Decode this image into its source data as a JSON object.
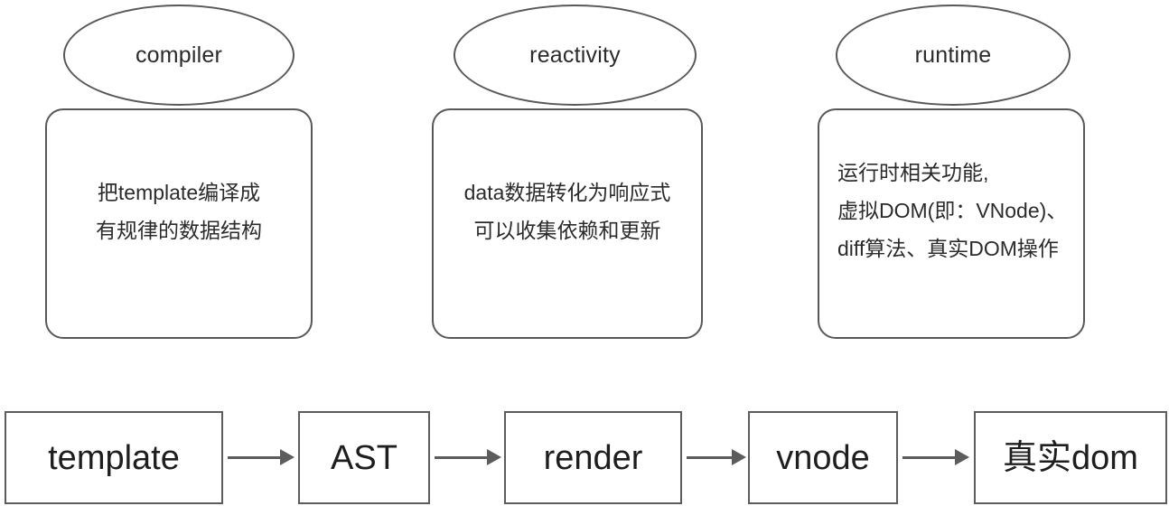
{
  "diagram": {
    "type": "flow-diagram",
    "stroke_color": "#585858",
    "text_color": "#2b2b2b",
    "background": "#ffffff",
    "concepts": [
      {
        "name": "compiler",
        "title": "compiler",
        "description": "把template编译成\n有规律的数据结构",
        "align": "center"
      },
      {
        "name": "reactivity",
        "title": "reactivity",
        "description": "data数据转化为响应式\n可以收集依赖和更新",
        "align": "center"
      },
      {
        "name": "runtime",
        "title": "runtime",
        "description": "运行时相关功能,\n虚拟DOM(即：VNode)、\ndiff算法、真实DOM操作",
        "align": "left"
      }
    ],
    "pipeline": {
      "steps": [
        {
          "name": "template",
          "label": "template"
        },
        {
          "name": "ast",
          "label": "AST"
        },
        {
          "name": "render",
          "label": "render"
        },
        {
          "name": "vnode",
          "label": "vnode"
        },
        {
          "name": "real-dom",
          "label": "真实dom"
        }
      ],
      "arrow_count": 4,
      "arrow_direction": "right"
    }
  }
}
